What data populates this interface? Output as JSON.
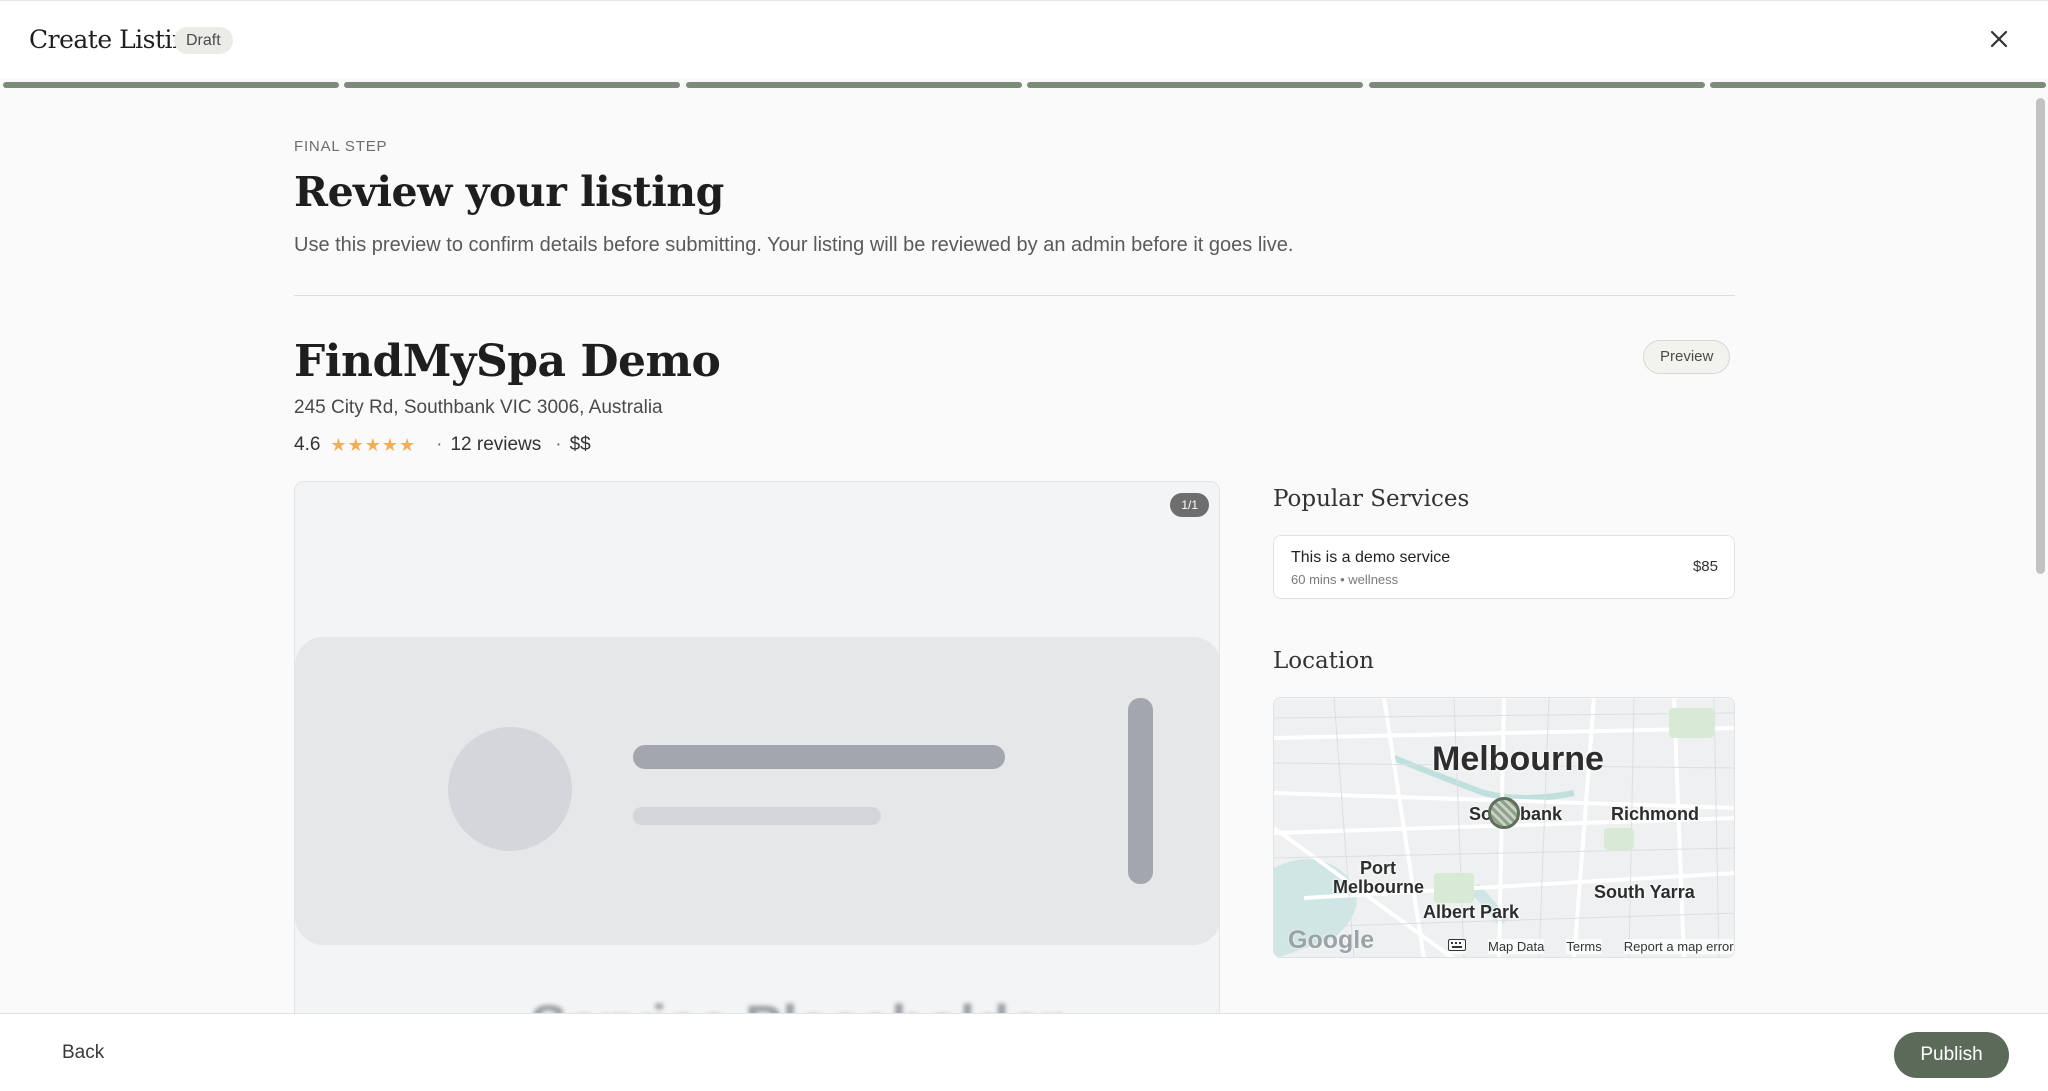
{
  "header": {
    "title": "Create Listing",
    "status_badge": "Draft",
    "close_icon": "close-icon",
    "progress_steps": 6,
    "progress_color": "#7d8b7b"
  },
  "intro": {
    "eyebrow": "FINAL STEP",
    "heading": "Review your listing",
    "description": "Use this preview to confirm details before submitting. Your listing will be reviewed by an admin before it goes live."
  },
  "listing": {
    "name": "FindMySpa Demo",
    "preview_label": "Preview",
    "address": "245 City Rd, Southbank VIC 3006, Australia",
    "rating": "4.6",
    "stars": 5,
    "star_color": "#f0ad5a",
    "separator": "·",
    "reviews": "12 reviews",
    "price_level": "$$"
  },
  "gallery": {
    "counter": "1/1",
    "caption": "Service Placeholder"
  },
  "services": {
    "title": "Popular Services",
    "items": [
      {
        "name": "This is a demo service",
        "meta": "60 mins • wellness",
        "price": "$85"
      }
    ]
  },
  "location": {
    "title": "Location",
    "map_labels": {
      "city": "Melbourne",
      "southbank": "Southbank",
      "richmond": "Richmond",
      "port_melbourne_1": "Port",
      "port_melbourne_2": "Melbourne",
      "albert_park": "Albert Park",
      "south_yarra": "South Yarra"
    },
    "logo": "Google",
    "links": {
      "keyboard_icon": "keyboard-icon",
      "map_data": "Map Data",
      "terms": "Terms",
      "report": "Report a map error"
    }
  },
  "footer": {
    "back_label": "Back",
    "publish_label": "Publish",
    "publish_color": "#5c6b59"
  }
}
